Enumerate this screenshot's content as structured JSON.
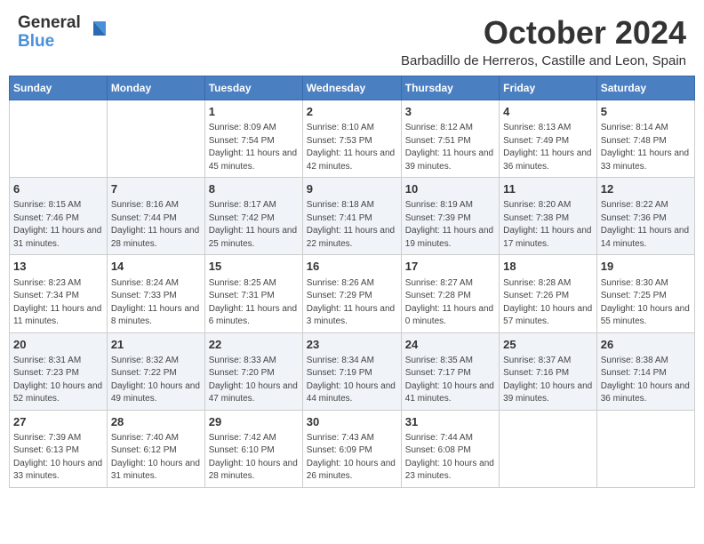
{
  "header": {
    "logo_line1": "General",
    "logo_line2": "Blue",
    "month_title": "October 2024",
    "subtitle": "Barbadillo de Herreros, Castille and Leon, Spain"
  },
  "weekdays": [
    "Sunday",
    "Monday",
    "Tuesday",
    "Wednesday",
    "Thursday",
    "Friday",
    "Saturday"
  ],
  "weeks": [
    [
      {
        "num": "",
        "info": ""
      },
      {
        "num": "",
        "info": ""
      },
      {
        "num": "1",
        "info": "Sunrise: 8:09 AM\nSunset: 7:54 PM\nDaylight: 11 hours and 45 minutes."
      },
      {
        "num": "2",
        "info": "Sunrise: 8:10 AM\nSunset: 7:53 PM\nDaylight: 11 hours and 42 minutes."
      },
      {
        "num": "3",
        "info": "Sunrise: 8:12 AM\nSunset: 7:51 PM\nDaylight: 11 hours and 39 minutes."
      },
      {
        "num": "4",
        "info": "Sunrise: 8:13 AM\nSunset: 7:49 PM\nDaylight: 11 hours and 36 minutes."
      },
      {
        "num": "5",
        "info": "Sunrise: 8:14 AM\nSunset: 7:48 PM\nDaylight: 11 hours and 33 minutes."
      }
    ],
    [
      {
        "num": "6",
        "info": "Sunrise: 8:15 AM\nSunset: 7:46 PM\nDaylight: 11 hours and 31 minutes."
      },
      {
        "num": "7",
        "info": "Sunrise: 8:16 AM\nSunset: 7:44 PM\nDaylight: 11 hours and 28 minutes."
      },
      {
        "num": "8",
        "info": "Sunrise: 8:17 AM\nSunset: 7:42 PM\nDaylight: 11 hours and 25 minutes."
      },
      {
        "num": "9",
        "info": "Sunrise: 8:18 AM\nSunset: 7:41 PM\nDaylight: 11 hours and 22 minutes."
      },
      {
        "num": "10",
        "info": "Sunrise: 8:19 AM\nSunset: 7:39 PM\nDaylight: 11 hours and 19 minutes."
      },
      {
        "num": "11",
        "info": "Sunrise: 8:20 AM\nSunset: 7:38 PM\nDaylight: 11 hours and 17 minutes."
      },
      {
        "num": "12",
        "info": "Sunrise: 8:22 AM\nSunset: 7:36 PM\nDaylight: 11 hours and 14 minutes."
      }
    ],
    [
      {
        "num": "13",
        "info": "Sunrise: 8:23 AM\nSunset: 7:34 PM\nDaylight: 11 hours and 11 minutes."
      },
      {
        "num": "14",
        "info": "Sunrise: 8:24 AM\nSunset: 7:33 PM\nDaylight: 11 hours and 8 minutes."
      },
      {
        "num": "15",
        "info": "Sunrise: 8:25 AM\nSunset: 7:31 PM\nDaylight: 11 hours and 6 minutes."
      },
      {
        "num": "16",
        "info": "Sunrise: 8:26 AM\nSunset: 7:29 PM\nDaylight: 11 hours and 3 minutes."
      },
      {
        "num": "17",
        "info": "Sunrise: 8:27 AM\nSunset: 7:28 PM\nDaylight: 11 hours and 0 minutes."
      },
      {
        "num": "18",
        "info": "Sunrise: 8:28 AM\nSunset: 7:26 PM\nDaylight: 10 hours and 57 minutes."
      },
      {
        "num": "19",
        "info": "Sunrise: 8:30 AM\nSunset: 7:25 PM\nDaylight: 10 hours and 55 minutes."
      }
    ],
    [
      {
        "num": "20",
        "info": "Sunrise: 8:31 AM\nSunset: 7:23 PM\nDaylight: 10 hours and 52 minutes."
      },
      {
        "num": "21",
        "info": "Sunrise: 8:32 AM\nSunset: 7:22 PM\nDaylight: 10 hours and 49 minutes."
      },
      {
        "num": "22",
        "info": "Sunrise: 8:33 AM\nSunset: 7:20 PM\nDaylight: 10 hours and 47 minutes."
      },
      {
        "num": "23",
        "info": "Sunrise: 8:34 AM\nSunset: 7:19 PM\nDaylight: 10 hours and 44 minutes."
      },
      {
        "num": "24",
        "info": "Sunrise: 8:35 AM\nSunset: 7:17 PM\nDaylight: 10 hours and 41 minutes."
      },
      {
        "num": "25",
        "info": "Sunrise: 8:37 AM\nSunset: 7:16 PM\nDaylight: 10 hours and 39 minutes."
      },
      {
        "num": "26",
        "info": "Sunrise: 8:38 AM\nSunset: 7:14 PM\nDaylight: 10 hours and 36 minutes."
      }
    ],
    [
      {
        "num": "27",
        "info": "Sunrise: 7:39 AM\nSunset: 6:13 PM\nDaylight: 10 hours and 33 minutes."
      },
      {
        "num": "28",
        "info": "Sunrise: 7:40 AM\nSunset: 6:12 PM\nDaylight: 10 hours and 31 minutes."
      },
      {
        "num": "29",
        "info": "Sunrise: 7:42 AM\nSunset: 6:10 PM\nDaylight: 10 hours and 28 minutes."
      },
      {
        "num": "30",
        "info": "Sunrise: 7:43 AM\nSunset: 6:09 PM\nDaylight: 10 hours and 26 minutes."
      },
      {
        "num": "31",
        "info": "Sunrise: 7:44 AM\nSunset: 6:08 PM\nDaylight: 10 hours and 23 minutes."
      },
      {
        "num": "",
        "info": ""
      },
      {
        "num": "",
        "info": ""
      }
    ]
  ]
}
